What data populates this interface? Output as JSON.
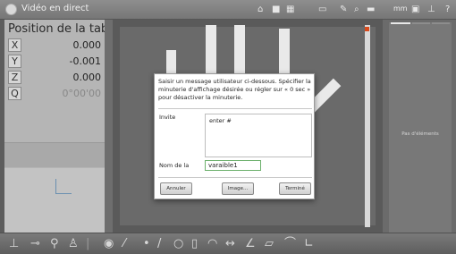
{
  "window": {
    "title": "Vidéo en direct"
  },
  "dro": {
    "title": "Position de la table",
    "axes": [
      {
        "label": "X",
        "value": "0.000"
      },
      {
        "label": "Y",
        "value": "-0.001"
      },
      {
        "label": "Z",
        "value": "0.000"
      },
      {
        "label": "Q",
        "value": "0°00'00"
      }
    ]
  },
  "topbar": {
    "unit": "mm",
    "icons": [
      "home-icon",
      "camera-icon",
      "grid-icon",
      "measure-icon",
      "probe-icon",
      "magnify-icon",
      "settings-icon",
      "help-icon"
    ]
  },
  "dialog": {
    "message": "Saisir un message utilisateur ci-dessous. Spécifier la minuterie d'affichage désirée ou régler sur « 0 sec » pour désactiver la minuterie.",
    "prompt_label": "Invite",
    "prompt_value": "enter #",
    "variable_label": "Nom de la",
    "variable_value": "varaible1",
    "buttons": {
      "cancel": "Annuler",
      "image": "Image...",
      "done": "Terminé"
    }
  },
  "right_panel": {
    "empty_text": "Pas d'éléments"
  },
  "colors": {
    "accent_tab": "#e8e8e8",
    "input_focus": "#6cb06c",
    "marker": "#d94a1c"
  }
}
